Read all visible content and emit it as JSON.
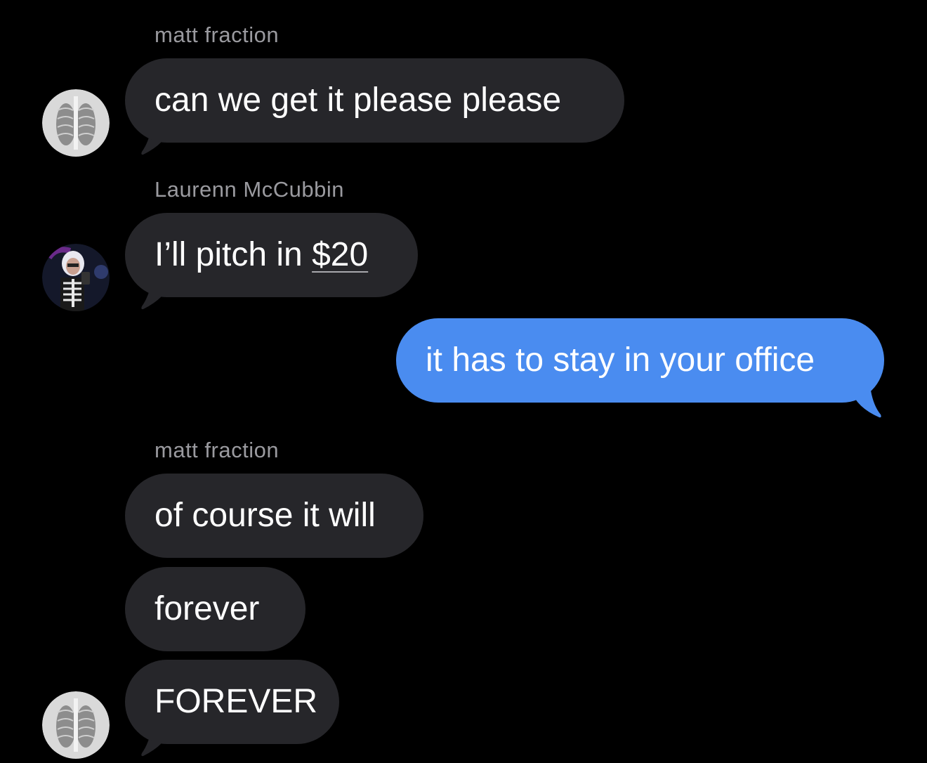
{
  "messages": [
    {
      "sender": "matt fraction",
      "text": "can we get it please please",
      "direction": "incoming"
    },
    {
      "sender": "Laurenn McCubbin",
      "text_prefix": "I’ll pitch in ",
      "amount": "$20",
      "direction": "incoming"
    },
    {
      "text": "it has to stay in your office",
      "direction": "outgoing"
    },
    {
      "sender": "matt fraction",
      "text": "of course it will",
      "direction": "incoming"
    },
    {
      "text": "forever",
      "direction": "incoming"
    },
    {
      "text": "FOREVER",
      "direction": "incoming"
    }
  ],
  "avatars": {
    "matt": "xray-chest-avatar",
    "laurenn": "selfie-avatar"
  },
  "colors": {
    "background": "#000000",
    "incoming_bubble": "#26262a",
    "outgoing_bubble": "#4a8cf0",
    "sender_label": "#9a9a9f"
  }
}
